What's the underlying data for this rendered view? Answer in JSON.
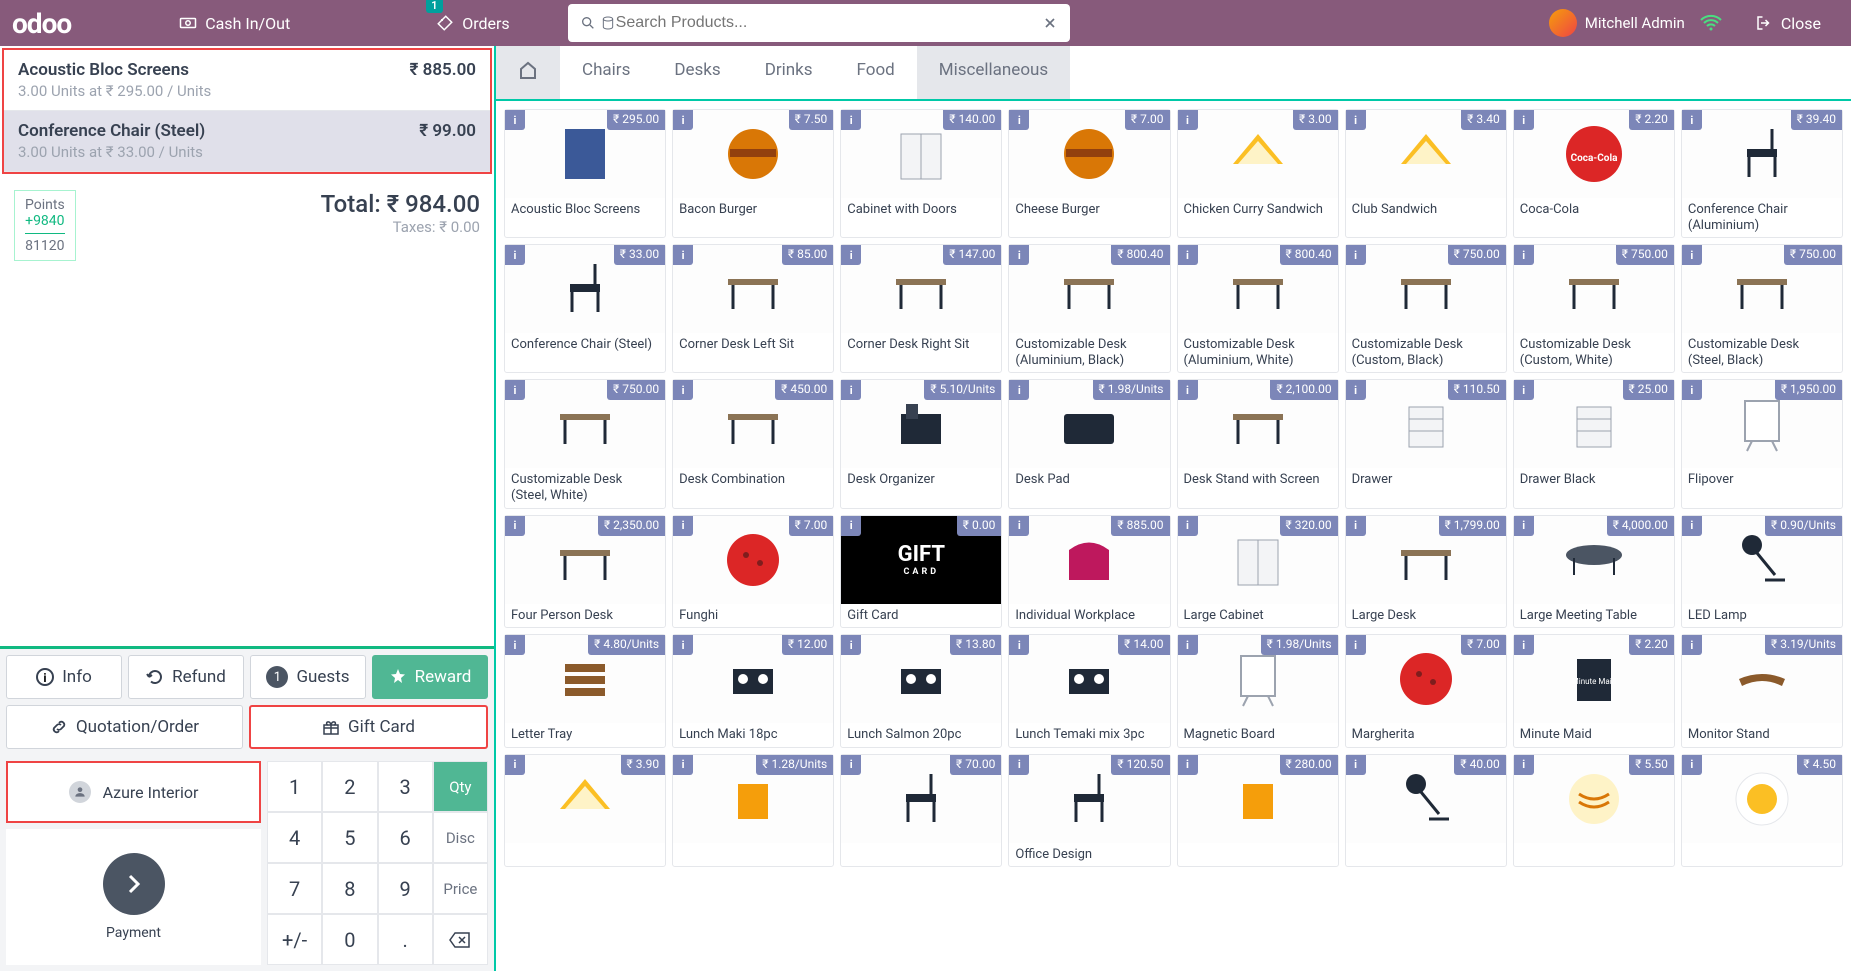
{
  "topbar": {
    "logo": "odoo",
    "cash": "Cash In/Out",
    "orders": "Orders",
    "orders_badge": "1",
    "search_placeholder": "Search Products...",
    "user": "Mitchell Admin",
    "close": "Close"
  },
  "order": {
    "lines": [
      {
        "name": "Acoustic Bloc Screens",
        "sub": "3.00 Units at ₹ 295.00 / Units",
        "amt": "₹ 885.00",
        "selected": false
      },
      {
        "name": "Conference Chair (Steel)",
        "sub": "3.00 Units at ₹ 33.00 / Units",
        "amt": "₹ 99.00",
        "selected": true
      }
    ],
    "points_label": "Points",
    "points_add": "+9840",
    "points_total": "81120",
    "total": "Total: ₹ 984.00",
    "taxes": "Taxes: ₹ 0.00"
  },
  "actions": {
    "info": "Info",
    "refund": "Refund",
    "guests": "Guests",
    "guests_n": "1",
    "reward": "Reward",
    "quotation": "Quotation/Order",
    "giftcard": "Gift Card",
    "customer": "Azure Interior",
    "payment": "Payment"
  },
  "keypad": {
    "qty": "Qty",
    "disc": "Disc",
    "price": "Price",
    "k1": "1",
    "k2": "2",
    "k3": "3",
    "k4": "4",
    "k5": "5",
    "k6": "6",
    "k7": "7",
    "k8": "8",
    "k9": "9",
    "k0": "0",
    "pm": "+/-",
    "dot": "."
  },
  "categories": [
    "Chairs",
    "Desks",
    "Drinks",
    "Food",
    "Miscellaneous"
  ],
  "active_category": "Miscellaneous",
  "products": [
    {
      "name": "Acoustic Bloc Screens",
      "price": "₹ 295.00",
      "icon": "panel"
    },
    {
      "name": "Bacon Burger",
      "price": "₹ 7.50",
      "icon": "burger"
    },
    {
      "name": "Cabinet with Doors",
      "price": "₹ 140.00",
      "icon": "cabinet"
    },
    {
      "name": "Cheese Burger",
      "price": "₹ 7.00",
      "icon": "burger"
    },
    {
      "name": "Chicken Curry Sandwich",
      "price": "₹ 3.00",
      "icon": "sandwich"
    },
    {
      "name": "Club Sandwich",
      "price": "₹ 3.40",
      "icon": "sandwich"
    },
    {
      "name": "Coca-Cola",
      "price": "₹ 2.20",
      "icon": "coke"
    },
    {
      "name": "Conference Chair (Aluminium)",
      "price": "₹ 39.40",
      "icon": "chair"
    },
    {
      "name": "Conference Chair (Steel)",
      "price": "₹ 33.00",
      "icon": "chair"
    },
    {
      "name": "Corner Desk Left Sit",
      "price": "₹ 85.00",
      "icon": "desk"
    },
    {
      "name": "Corner Desk Right Sit",
      "price": "₹ 147.00",
      "icon": "desk"
    },
    {
      "name": "Customizable Desk (Aluminium, Black)",
      "price": "₹ 800.40",
      "icon": "desk"
    },
    {
      "name": "Customizable Desk (Aluminium, White)",
      "price": "₹ 800.40",
      "icon": "desk"
    },
    {
      "name": "Customizable Desk (Custom, Black)",
      "price": "₹ 750.00",
      "icon": "desk"
    },
    {
      "name": "Customizable Desk (Custom, White)",
      "price": "₹ 750.00",
      "icon": "desk"
    },
    {
      "name": "Customizable Desk (Steel, Black)",
      "price": "₹ 750.00",
      "icon": "desk"
    },
    {
      "name": "Customizable Desk (Steel, White)",
      "price": "₹ 750.00",
      "icon": "desk"
    },
    {
      "name": "Desk Combination",
      "price": "₹ 450.00",
      "icon": "desk"
    },
    {
      "name": "Desk Organizer",
      "price": "₹ 5.10/Units",
      "icon": "organizer"
    },
    {
      "name": "Desk Pad",
      "price": "₹ 1.98/Units",
      "icon": "pad"
    },
    {
      "name": "Desk Stand with Screen",
      "price": "₹ 2,100.00",
      "icon": "desk"
    },
    {
      "name": "Drawer",
      "price": "₹ 110.50",
      "icon": "drawer"
    },
    {
      "name": "Drawer Black",
      "price": "₹ 25.00",
      "icon": "drawer"
    },
    {
      "name": "Flipover",
      "price": "₹ 1,950.00",
      "icon": "board"
    },
    {
      "name": "Four Person Desk",
      "price": "₹ 2,350.00",
      "icon": "desk"
    },
    {
      "name": "Funghi",
      "price": "₹ 7.00",
      "icon": "pizza"
    },
    {
      "name": "Gift Card",
      "price": "₹ 0.00",
      "icon": "gift"
    },
    {
      "name": "Individual Workplace",
      "price": "₹ 885.00",
      "icon": "booth"
    },
    {
      "name": "Large Cabinet",
      "price": "₹ 320.00",
      "icon": "cabinet"
    },
    {
      "name": "Large Desk",
      "price": "₹ 1,799.00",
      "icon": "desk"
    },
    {
      "name": "Large Meeting Table",
      "price": "₹ 4,000.00",
      "icon": "table"
    },
    {
      "name": "LED Lamp",
      "price": "₹ 0.90/Units",
      "icon": "lamp"
    },
    {
      "name": "Letter Tray",
      "price": "₹ 4.80/Units",
      "icon": "tray"
    },
    {
      "name": "Lunch Maki 18pc",
      "price": "₹ 12.00",
      "icon": "sushi"
    },
    {
      "name": "Lunch Salmon 20pc",
      "price": "₹ 13.80",
      "icon": "sushi"
    },
    {
      "name": "Lunch Temaki mix 3pc",
      "price": "₹ 14.00",
      "icon": "sushi"
    },
    {
      "name": "Magnetic Board",
      "price": "₹ 1.98/Units",
      "icon": "board"
    },
    {
      "name": "Margherita",
      "price": "₹ 7.00",
      "icon": "pizza"
    },
    {
      "name": "Minute Maid",
      "price": "₹ 2.20",
      "icon": "juice"
    },
    {
      "name": "Monitor Stand",
      "price": "₹ 3.19/Units",
      "icon": "stand"
    },
    {
      "name": "",
      "price": "₹ 3.90",
      "icon": "sandwich"
    },
    {
      "name": "",
      "price": "₹ 1.28/Units",
      "icon": "box"
    },
    {
      "name": "",
      "price": "₹ 70.00",
      "icon": "chair"
    },
    {
      "name": "Office Design",
      "price": "₹ 120.50",
      "icon": "chair"
    },
    {
      "name": "",
      "price": "₹ 280.00",
      "icon": "box"
    },
    {
      "name": "",
      "price": "₹ 40.00",
      "icon": "lamp"
    },
    {
      "name": "",
      "price": "₹ 5.50",
      "icon": "pasta"
    },
    {
      "name": "",
      "price": "₹ 4.50",
      "icon": "food"
    }
  ]
}
